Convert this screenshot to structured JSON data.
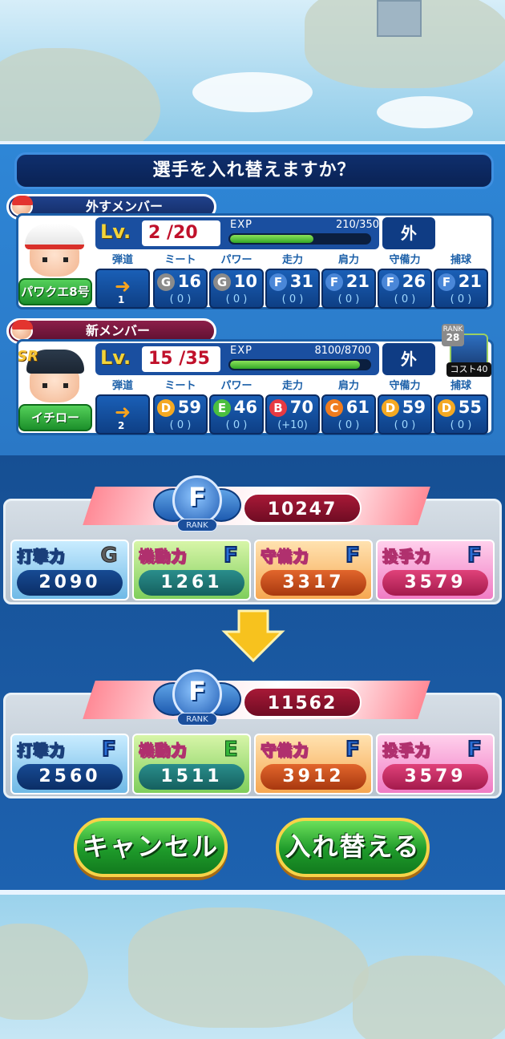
{
  "dialog": {
    "title": "選手を入れ替えますか？"
  },
  "out_member": {
    "tag": "外すメンバー",
    "name": "パワクエ8号",
    "lv_label": "Lv.",
    "level": "2",
    "max_level": "/20",
    "exp_label": "EXP",
    "exp_text": "210/350",
    "exp_ratio": 0.6,
    "position": "外",
    "trajectory": "1",
    "stats": [
      {
        "header": "ミート",
        "grade": "G",
        "value": "16",
        "bonus": "( 0 )"
      },
      {
        "header": "パワー",
        "grade": "G",
        "value": "10",
        "bonus": "( 0 )"
      },
      {
        "header": "走力",
        "grade": "F",
        "value": "31",
        "bonus": "( 0 )"
      },
      {
        "header": "肩力",
        "grade": "F",
        "value": "21",
        "bonus": "( 0 )"
      },
      {
        "header": "守備力",
        "grade": "F",
        "value": "26",
        "bonus": "( 0 )"
      },
      {
        "header": "捕球",
        "grade": "F",
        "value": "21",
        "bonus": "( 0 )"
      }
    ],
    "trajectory_header": "弾道"
  },
  "new_member": {
    "tag": "新メンバー",
    "name": "イチロー",
    "rarity": "SR",
    "lv_label": "Lv.",
    "level": "15",
    "max_level": "/35",
    "exp_label": "EXP",
    "exp_text": "8100/8700",
    "exp_ratio": 0.93,
    "position": "外",
    "rank_label": "RANK",
    "rank_value": "28",
    "cost": "コスト40",
    "trajectory": "2",
    "trajectory_header": "弾道",
    "stats": [
      {
        "header": "ミート",
        "grade": "D",
        "value": "59",
        "bonus": "( 0 )"
      },
      {
        "header": "パワー",
        "grade": "E",
        "value": "46",
        "bonus": "( 0 )"
      },
      {
        "header": "走力",
        "grade": "B",
        "value": "70",
        "bonus": "(+10)"
      },
      {
        "header": "肩力",
        "grade": "C",
        "value": "61",
        "bonus": "( 0 )"
      },
      {
        "header": "守備力",
        "grade": "D",
        "value": "59",
        "bonus": "( 0 )"
      },
      {
        "header": "捕球",
        "grade": "D",
        "value": "55",
        "bonus": "( 0 )"
      }
    ]
  },
  "before": {
    "rank_grade": "F",
    "rank_label": "RANK",
    "total": "10247",
    "categories": [
      {
        "name": "打撃力",
        "grade": "G",
        "value": "2090"
      },
      {
        "name": "機動力",
        "grade": "F",
        "value": "1261"
      },
      {
        "name": "守備力",
        "grade": "F",
        "value": "3317"
      },
      {
        "name": "投手力",
        "grade": "F",
        "value": "3579"
      }
    ]
  },
  "after": {
    "rank_grade": "F",
    "rank_label": "RANK",
    "total": "11562",
    "categories": [
      {
        "name": "打撃力",
        "grade": "F",
        "value": "2560"
      },
      {
        "name": "機動力",
        "grade": "E",
        "value": "1511"
      },
      {
        "name": "守備力",
        "grade": "F",
        "value": "3912"
      },
      {
        "name": "投手力",
        "grade": "F",
        "value": "3579"
      }
    ]
  },
  "buttons": {
    "cancel": "キャンセル",
    "confirm": "入れ替える"
  },
  "colors": {
    "accent_blue": "#1b5fa8",
    "button_green": "#1e9a2a",
    "button_border": "#f7d348",
    "total_red": "#a81937"
  }
}
